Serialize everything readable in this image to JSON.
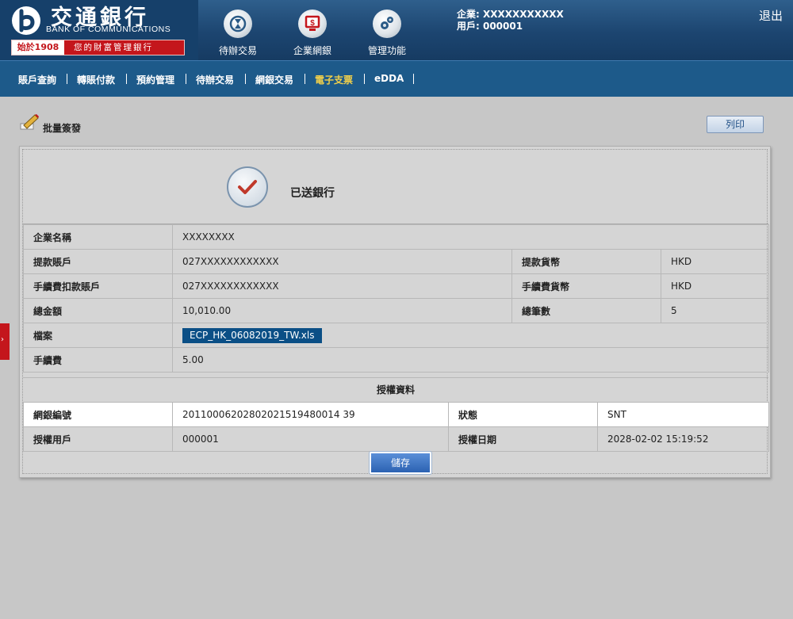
{
  "brand": {
    "name_cn": "交通銀行",
    "name_en": "BANK OF COMMUNICATIONS",
    "since": "始於1908",
    "slogan": "您的財富管理銀行"
  },
  "header_nav": [
    {
      "label": "待辦交易",
      "icon": "hourglass-icon"
    },
    {
      "label": "企業網銀",
      "icon": "monitor-dollar-icon"
    },
    {
      "label": "管理功能",
      "icon": "gears-icon"
    }
  ],
  "user": {
    "company": "企業: XXXXXXXXXXX",
    "user": "用戶: 000001"
  },
  "logout": "退出",
  "menu": [
    {
      "label": "賬戶查詢",
      "active": false
    },
    {
      "label": "轉賬付款",
      "active": false
    },
    {
      "label": "預約管理",
      "active": false
    },
    {
      "label": "待辦交易",
      "active": false
    },
    {
      "label": "網銀交易",
      "active": false
    },
    {
      "label": "電子支票",
      "active": true
    },
    {
      "label": "eDDA",
      "active": false
    }
  ],
  "page": {
    "title": "批量簽發",
    "print_button": "列印",
    "status": "已送銀行"
  },
  "details": {
    "company_name_label": "企業名稱",
    "company_name": "XXXXXXXX",
    "withdraw_account_label": "提款賬戶",
    "withdraw_account": "027XXXXXXXXXXXX",
    "withdraw_currency_label": "提款貨幣",
    "withdraw_currency": "HKD",
    "fee_account_label": "手續費扣款賬戶",
    "fee_account": "027XXXXXXXXXXXX",
    "fee_currency_label": "手續費貨幣",
    "fee_currency": "HKD",
    "total_amount_label": "總金額",
    "total_amount": "10,010.00",
    "total_count_label": "總筆數",
    "total_count": "5",
    "file_label": "檔案",
    "file": "ECP_HK_06082019_TW.xls",
    "fee_label": "手續費",
    "fee": "5.00"
  },
  "auth": {
    "title": "授權資料",
    "ref_label": "網銀編號",
    "ref": "20110006202802021519480014 39",
    "status_label": "狀態",
    "status": "SNT",
    "user_label": "授權用戶",
    "user": "000001",
    "date_label": "授權日期",
    "date": "2028-02-02 15:19:52"
  },
  "save_button": "儲存",
  "colors": {
    "header_blue": "#1c4570",
    "menu_blue": "#1d5a8a",
    "active_menu": "#f2d04a",
    "brand_red": "#c4161c",
    "check_red": "#c0392b"
  }
}
